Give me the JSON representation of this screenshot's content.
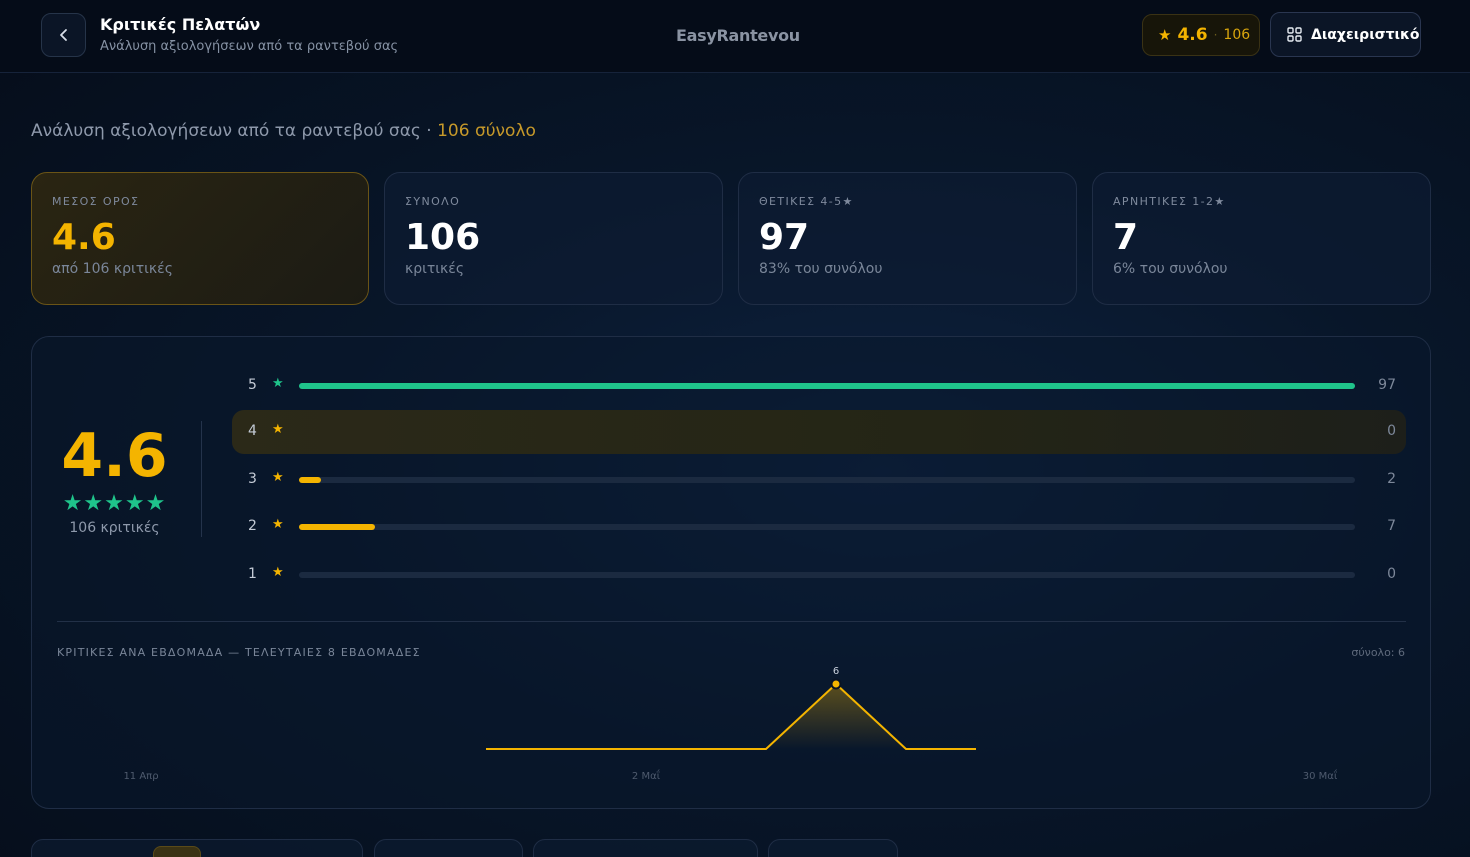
{
  "header": {
    "title": "Κριτικές Πελατών",
    "subtitle": "Ανάλυση αξιολογήσεων από τα ραντεβού σας",
    "brand": "EasyRantevou",
    "rating": "4.6",
    "rating_count": "106",
    "admin_label": "Διαχειριστικό"
  },
  "intro": {
    "text": "Ανάλυση αξιολογήσεων από τα ραντεβού σας · ",
    "total_text": "106 σύνολο"
  },
  "stats": [
    {
      "label": "ΜΕΣΟΣ ΟΡΟΣ",
      "value": "4.6",
      "note": "από 106 κριτικές"
    },
    {
      "label": "ΣΥΝΟΛΟ",
      "value": "106",
      "note": "κριτικές"
    },
    {
      "label": "ΘΕΤΙΚΕΣ 4-5★",
      "value": "97",
      "note": "83% του συνόλου"
    },
    {
      "label": "ΑΡΝΗΤΙΚΕΣ 1-2★",
      "value": "7",
      "note": "6% του συνόλου"
    }
  ],
  "summary": {
    "average": "4.6",
    "stars": "★★★★★",
    "count_text": "106 κριτικές"
  },
  "distribution": [
    {
      "stars": "5",
      "count": "97",
      "value": 97
    },
    {
      "stars": "4",
      "count": "0",
      "value": 0
    },
    {
      "stars": "3",
      "count": "2",
      "value": 2
    },
    {
      "stars": "2",
      "count": "7",
      "value": 7
    },
    {
      "stars": "1",
      "count": "0",
      "value": 0
    }
  ],
  "weekly": {
    "title": "ΚΡΙΤΙΚΕΣ ΑΝΑ ΕΒΔΟΜΑΔΑ — ΤΕΛΕΥΤΑΙΕΣ 8 ΕΒΔΟΜΑΔΕΣ",
    "total": "σύνολο: 6"
  },
  "chart_data": {
    "type": "area",
    "title": "ΚΡΙΤΙΚΕΣ ΑΝΑ ΕΒΔΟΜΑΔΑ — ΤΕΛΕΥΤΑΙΕΣ 8 ΕΒΔΟΜΑΔΕΣ",
    "x_tick_labels": [
      "11 Απρ",
      "2 Μαΐ",
      "30 Μαΐ"
    ],
    "series": [
      {
        "values": [
          0,
          0,
          0,
          0,
          0,
          6,
          0,
          0
        ]
      }
    ],
    "point_labels": [
      {
        "index": 5,
        "text": "6"
      }
    ],
    "ylim": [
      0,
      6
    ],
    "grid": false
  },
  "colors": {
    "accent": "#f4b400",
    "positive": "#1fc48b",
    "bar_track": "#1b2a40"
  }
}
